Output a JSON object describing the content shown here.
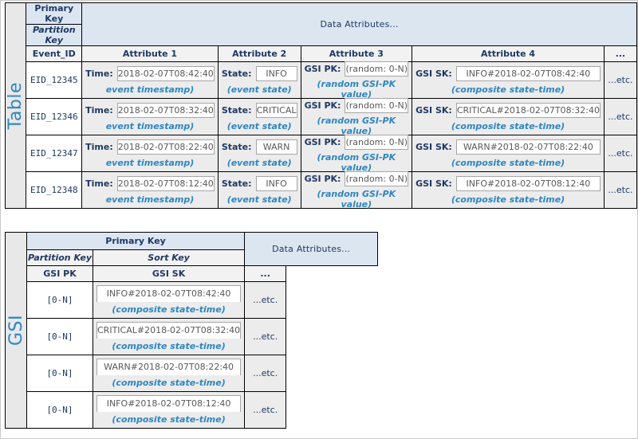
{
  "table": {
    "side_label": "Table",
    "headers": {
      "primary_key": "Primary Key",
      "partition_key": "Partition Key",
      "data_attributes": "Data Attributes...",
      "event_id": "Event_ID",
      "attribute_1": "Attribute 1",
      "attribute_2": "Attribute 2",
      "attribute_3": "Attribute 3",
      "attribute_4": "Attribute 4",
      "more": "..."
    },
    "labels": {
      "time": "Time:",
      "state": "State:",
      "gsi_pk": "GSI PK:",
      "gsi_sk": "GSI SK:",
      "etc": "...etc."
    },
    "captions": {
      "timestamp": "event timestamp)",
      "state": "(event state)",
      "gsi_pk": "(random GSI-PK value)",
      "gsi_sk": "(composite state-time)"
    },
    "rows": [
      {
        "event_id": "EID_12345",
        "time": "2018-02-07T08:42:40",
        "state": "INFO",
        "gsi_pk": "(random: 0-N)",
        "gsi_sk": "INFO#2018-02-07T08:42:40"
      },
      {
        "event_id": "EID_12346",
        "time": "2018-02-07T08:32:40",
        "state": "CRITICAL",
        "gsi_pk": "(random: 0-N)",
        "gsi_sk": "CRITICAL#2018-02-07T08:32:40"
      },
      {
        "event_id": "EID_12347",
        "time": "2018-02-07T08:22:40",
        "state": "WARN",
        "gsi_pk": "(random: 0-N)",
        "gsi_sk": "WARN#2018-02-07T08:22:40"
      },
      {
        "event_id": "EID_12348",
        "time": "2018-02-07T08:12:40",
        "state": "INFO",
        "gsi_pk": "(random: 0-N)",
        "gsi_sk": "INFO#2018-02-07T08:12:40"
      }
    ]
  },
  "gsi": {
    "side_label": "GSI",
    "headers": {
      "primary_key": "Primary Key",
      "partition_key": "Partition Key",
      "sort_key": "Sort Key",
      "data_attributes": "Data Attributes...",
      "gsi_pk": "GSI PK",
      "gsi_sk": "GSI SK",
      "more": "..."
    },
    "labels": {
      "etc": "...etc."
    },
    "captions": {
      "gsi_sk": "(composite state-time)"
    },
    "rows": [
      {
        "gsi_pk": "[0-N]",
        "gsi_sk": "INFO#2018-02-07T08:42:40"
      },
      {
        "gsi_pk": "[0-N]",
        "gsi_sk": "CRITICAL#2018-02-07T08:32:40"
      },
      {
        "gsi_pk": "[0-N]",
        "gsi_sk": "WARN#2018-02-07T08:22:40"
      },
      {
        "gsi_pk": "[0-N]",
        "gsi_sk": "INFO#2018-02-07T08:12:40"
      }
    ]
  },
  "colors": {
    "header_blue": "#dce6f1",
    "accent_blue": "#2E86C1",
    "dark_navy": "#1F3864",
    "cell_gray": "#ececec",
    "sub_gray": "#f2f2f2"
  }
}
